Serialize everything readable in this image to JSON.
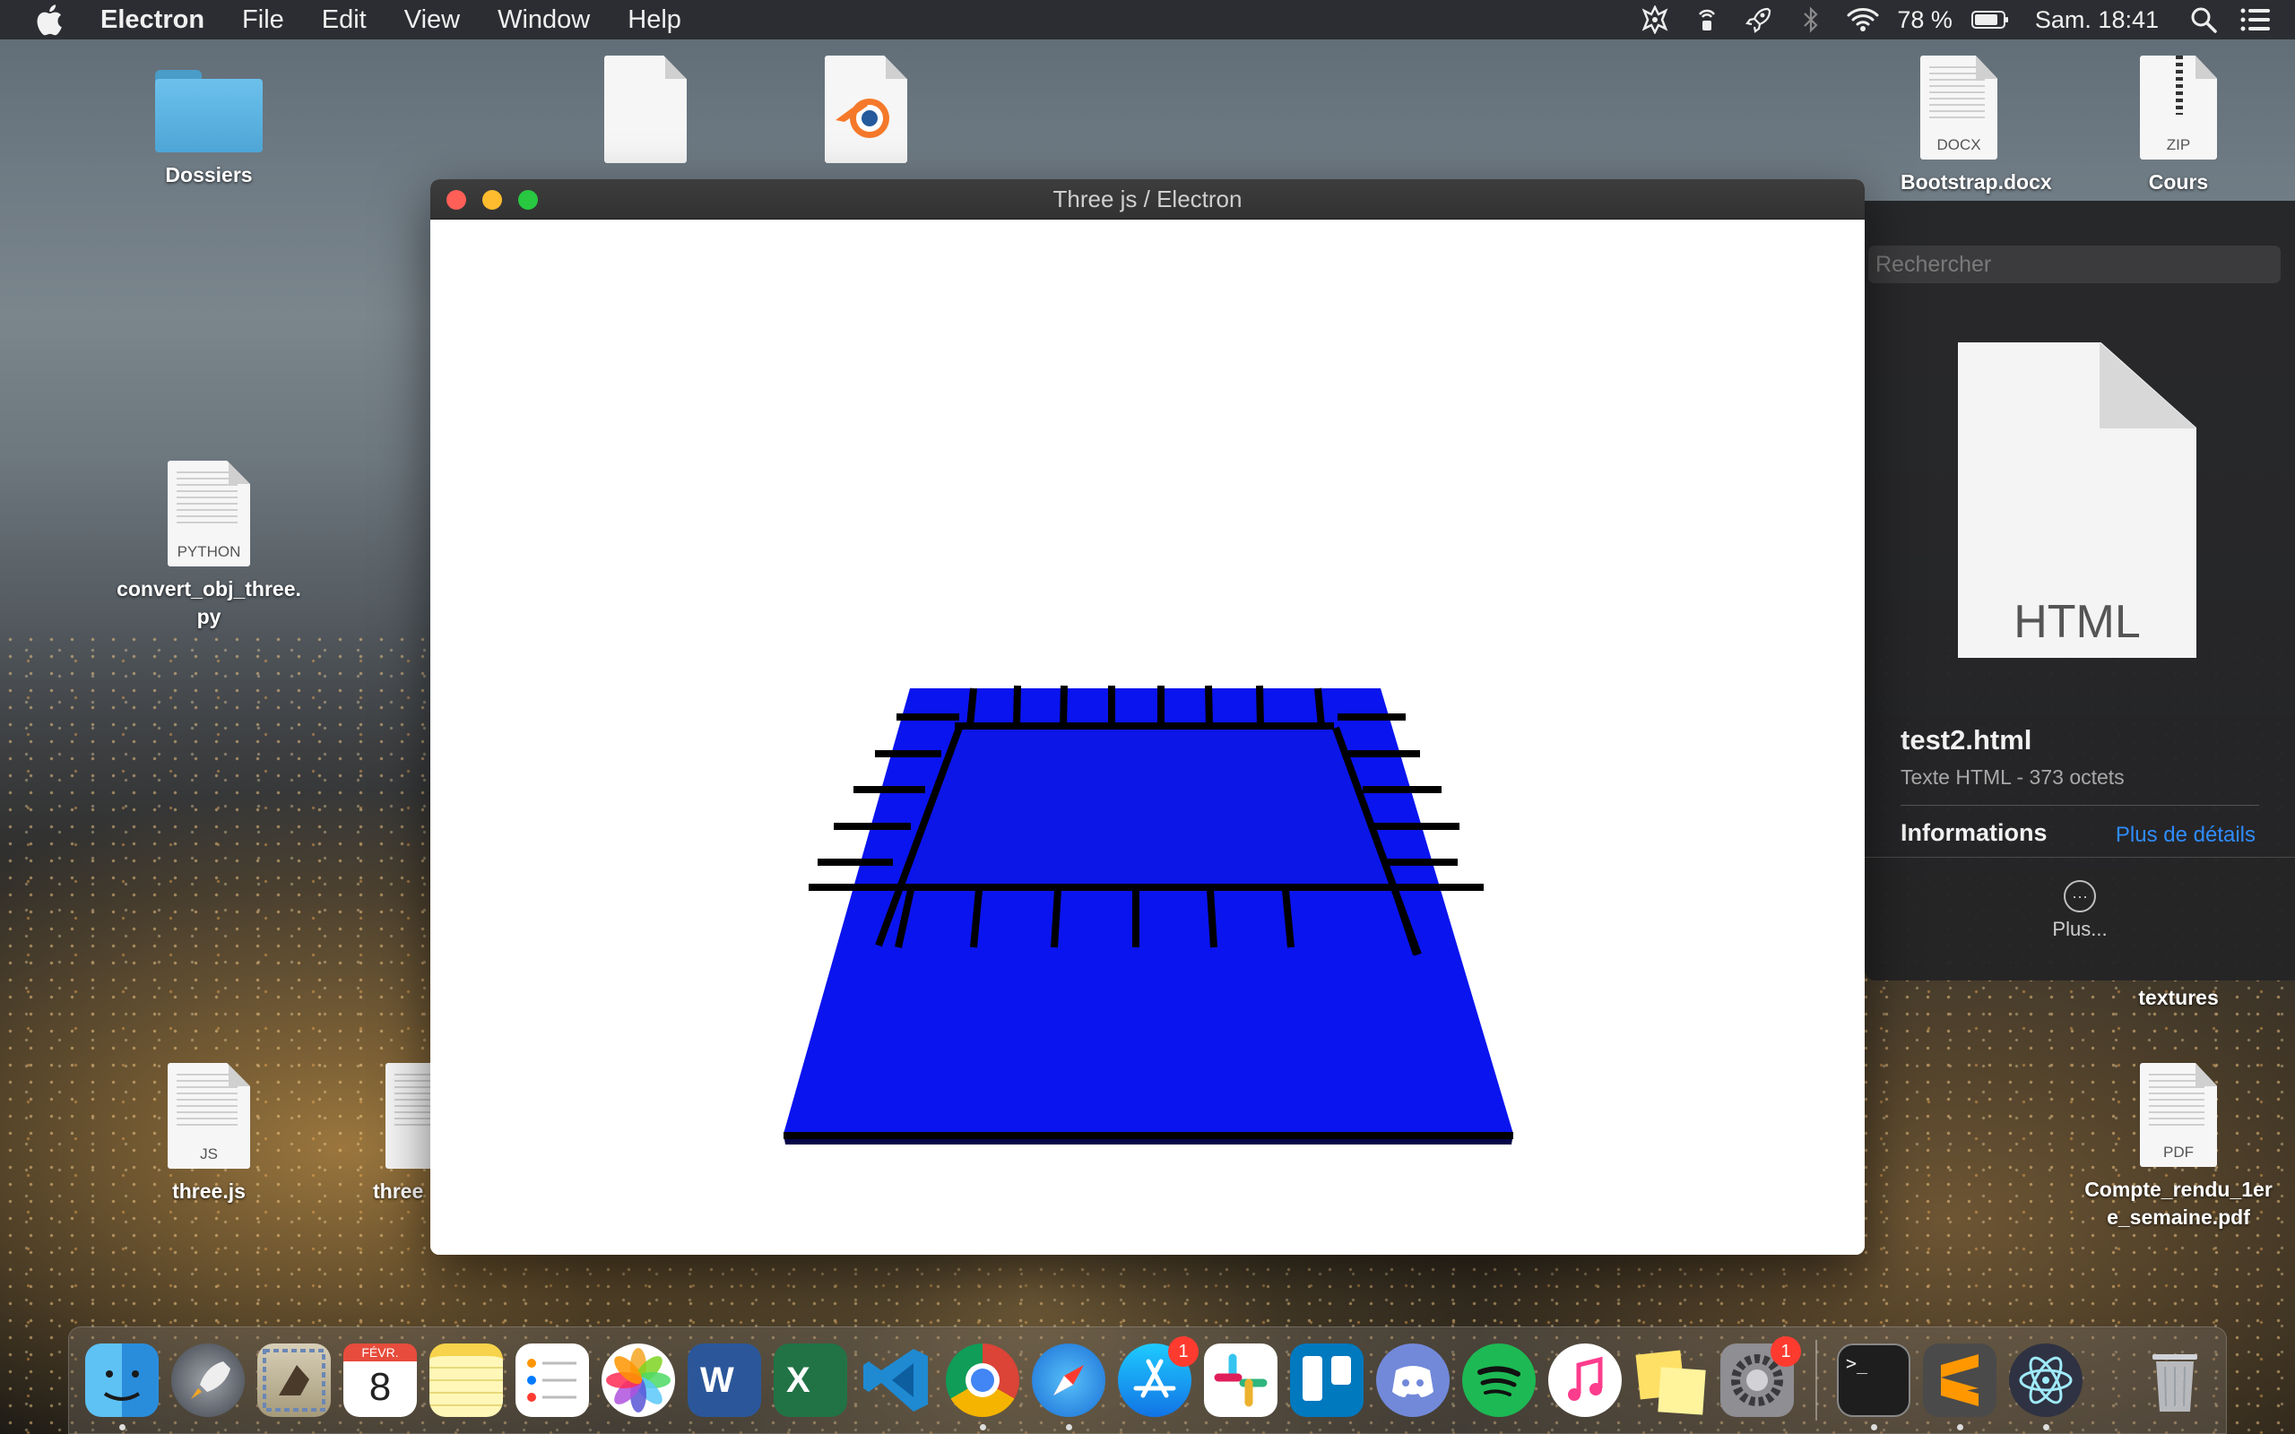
{
  "menubar": {
    "app_name": "Electron",
    "items": [
      "File",
      "Edit",
      "View",
      "Window",
      "Help"
    ],
    "battery": "78 %",
    "clock": "Sam. 18:41"
  },
  "desktop": {
    "folder_label": "Dossiers",
    "python_label": "convert_obj_three.\npy",
    "python_ext": "PYTHON",
    "docx_label": "Bootstrap.docx",
    "docx_ext": "DOCX",
    "zip_label": "Cours",
    "zip_ext": "ZIP",
    "textures_label": "textures",
    "js_label": "three.js",
    "js_ext": "JS",
    "js2_label": "three",
    "js2_ext": "J",
    "pdf_label": "Compte_rendu_1er\ne_semaine.pdf",
    "pdf_ext": "PDF"
  },
  "window": {
    "title": "Three js / Electron"
  },
  "finder_panel": {
    "search_placeholder": "Rechercher",
    "preview_ext": "HTML",
    "file_name": "test2.html",
    "file_meta": "Texte HTML - 373 octets",
    "info_title": "Informations",
    "info_link": "Plus de détails",
    "more_label": "Plus..."
  },
  "dock": {
    "calendar_month": "FÉVR.",
    "calendar_day": "8",
    "appstore_badge": "1",
    "prefs_badge": "1",
    "word_letter": "W",
    "excel_letter": "X",
    "terminal_prompt": ">_"
  },
  "colors": {
    "board_blue": "#0a14ee",
    "link_blue": "#2f8cff"
  }
}
